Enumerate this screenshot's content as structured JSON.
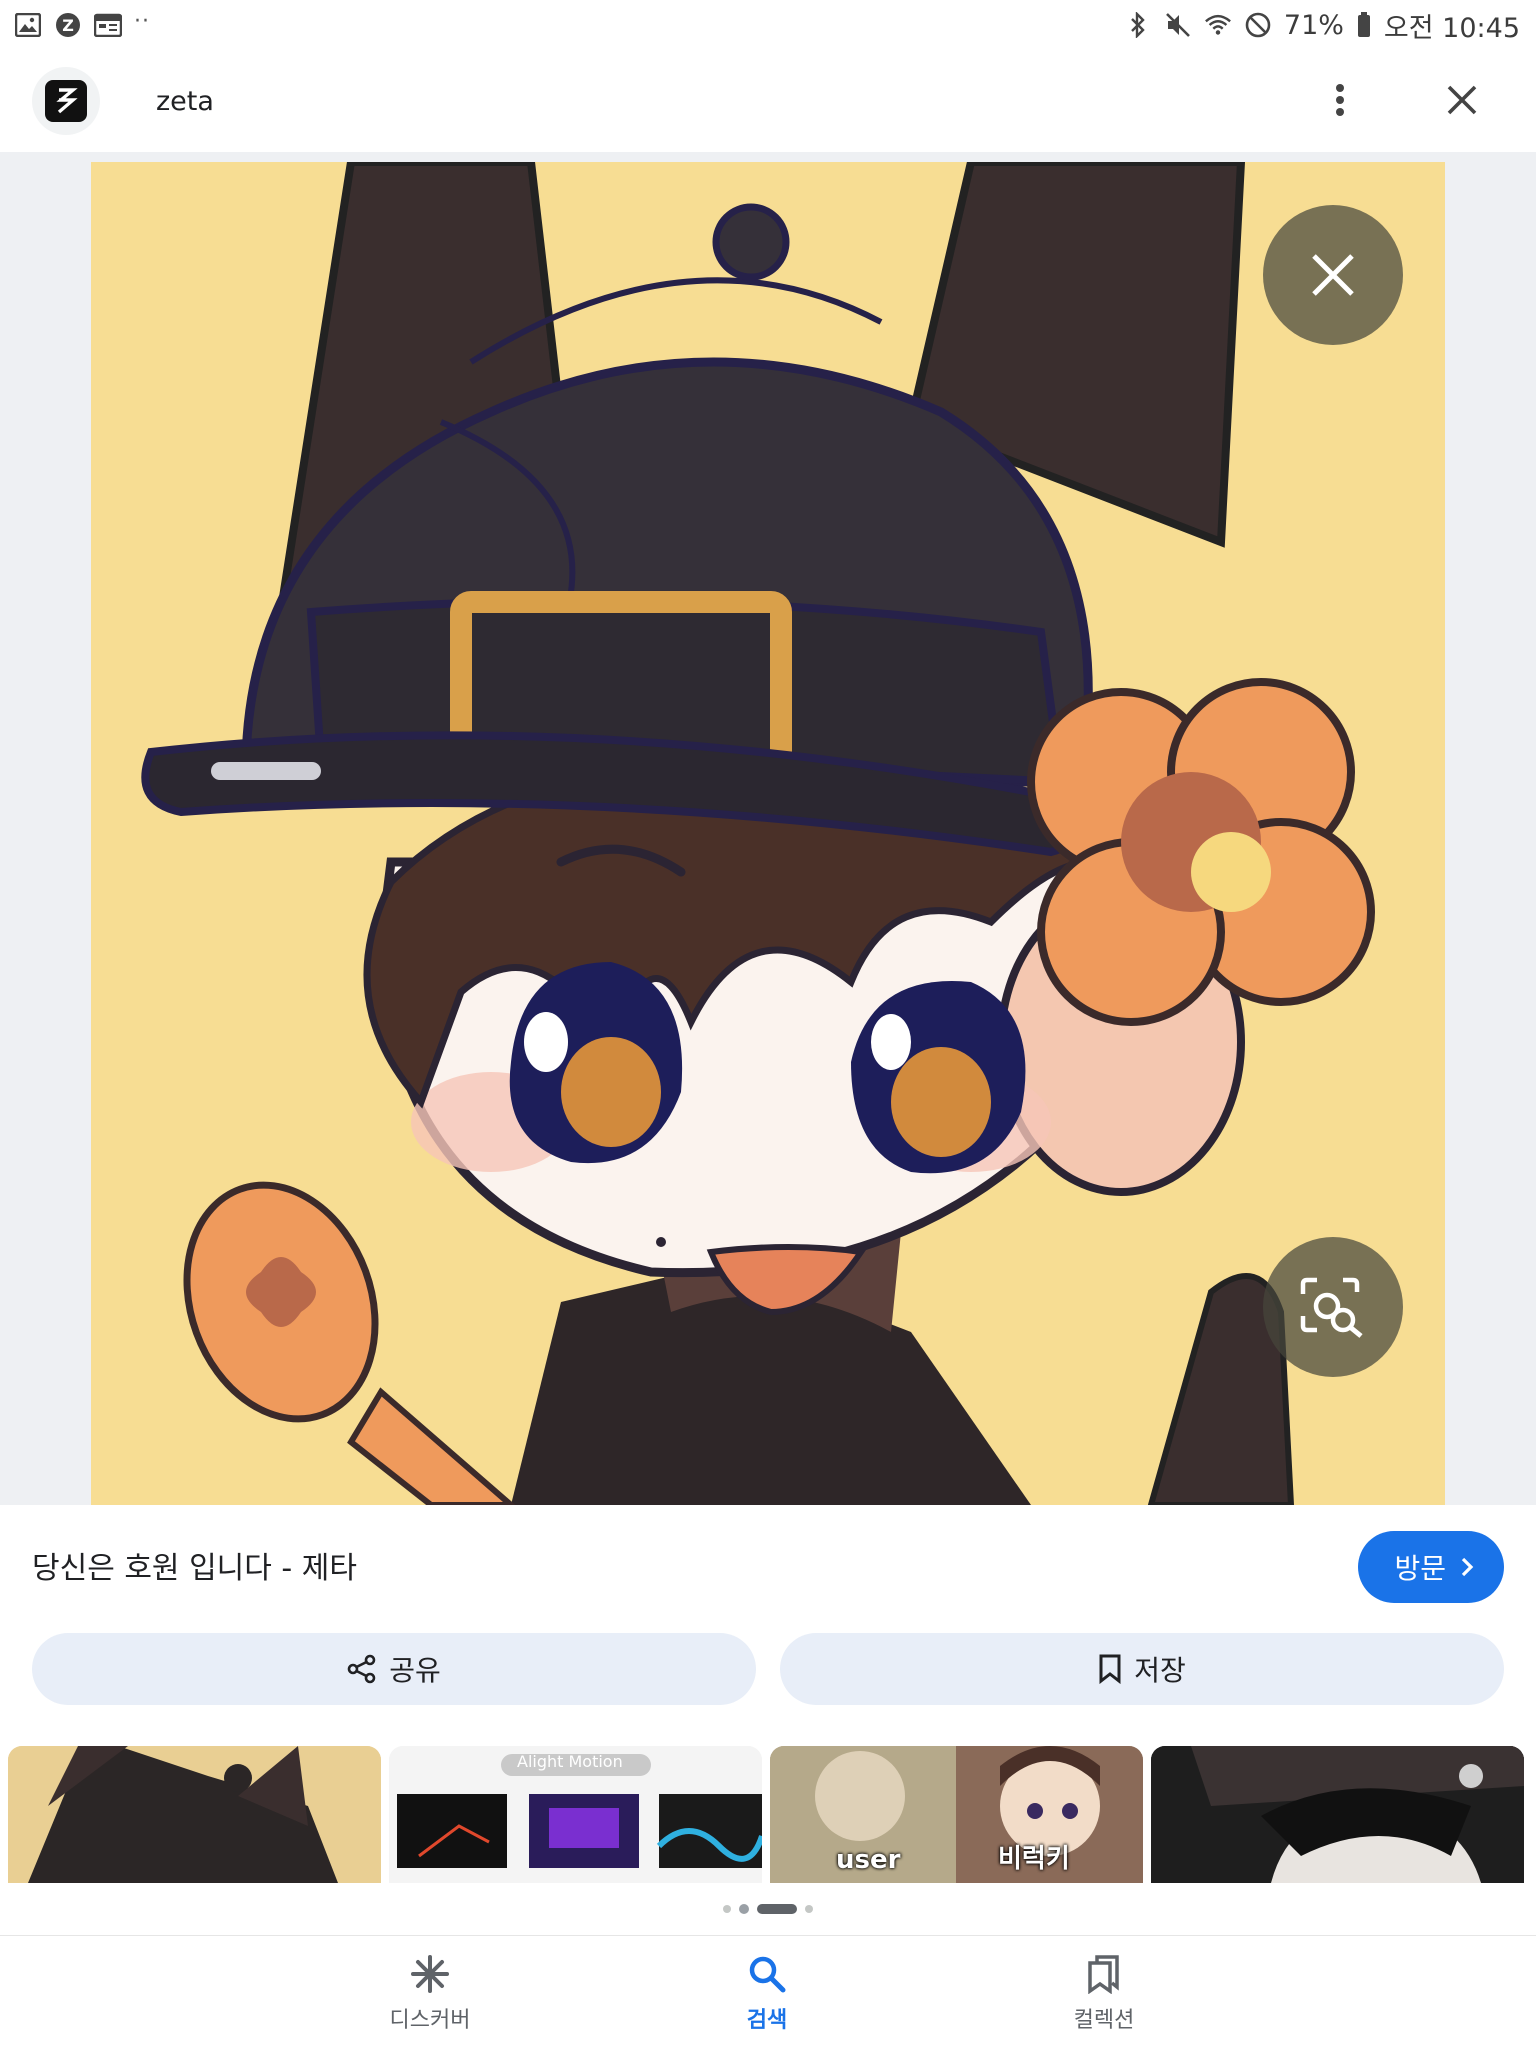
{
  "status_bar": {
    "left_icons": [
      "gallery-icon",
      "zeta-app-icon",
      "calendar-icon"
    ],
    "more_dots": "··",
    "right_icons": [
      "bluetooth-icon",
      "mute-icon",
      "wifi-icon",
      "do-not-disturb-icon",
      "battery-icon"
    ],
    "battery_percent": "71%",
    "time": "오전 10:45"
  },
  "header": {
    "site_name": "zeta",
    "menu_icon": "more-vert-icon",
    "close_icon": "close-icon"
  },
  "image_overlay": {
    "close_icon": "close-icon",
    "lens_icon": "google-lens-icon"
  },
  "result": {
    "title": "당신은 호원 입니다 - 제타",
    "visit_label": "방문"
  },
  "actions": {
    "share_label": "공유",
    "save_label": "저장"
  },
  "related": {
    "thumbs": [
      {
        "label": ""
      },
      {
        "label": "Alight Motion"
      },
      {
        "label_left": "user",
        "label_right": "비럭키"
      },
      {
        "label": ""
      }
    ]
  },
  "pager": {
    "count": 4,
    "active_index": 2
  },
  "bottom_nav": {
    "items": [
      {
        "label": "디스커버",
        "icon": "asterisk-icon",
        "active": false
      },
      {
        "label": "검색",
        "icon": "search-icon",
        "active": true
      },
      {
        "label": "컬렉션",
        "icon": "collections-icon",
        "active": false
      }
    ]
  },
  "colors": {
    "accent": "#1a73e8",
    "pill_bg": "#e8eef8",
    "art_bg": "#f7dd93"
  }
}
